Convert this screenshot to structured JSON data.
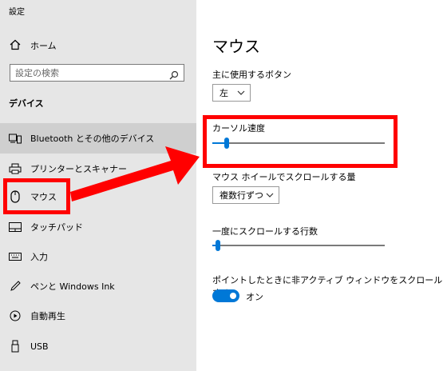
{
  "app_title": "設定",
  "home": {
    "label": "ホーム",
    "icon": "home-icon"
  },
  "search": {
    "placeholder": "設定の検索",
    "icon": "search-icon"
  },
  "section_title": "デバイス",
  "sidebar": {
    "items": [
      {
        "label": "Bluetooth とその他のデバイス",
        "icon": "bluetooth-devices-icon",
        "hover": true
      },
      {
        "label": "プリンターとスキャナー",
        "icon": "printer-icon"
      },
      {
        "label": "マウス",
        "icon": "mouse-icon",
        "selected": true
      },
      {
        "label": "タッチパッド",
        "icon": "touchpad-icon"
      },
      {
        "label": "入力",
        "icon": "keyboard-icon"
      },
      {
        "label": "ペンと Windows Ink",
        "icon": "pen-icon"
      },
      {
        "label": "自動再生",
        "icon": "autoplay-icon"
      },
      {
        "label": "USB",
        "icon": "usb-icon"
      }
    ]
  },
  "main": {
    "title": "マウス",
    "primary_button": {
      "label": "主に使用するボタン",
      "value": "左"
    },
    "cursor_speed": {
      "label": "カーソル速度",
      "value": 0.07
    },
    "wheel_scroll": {
      "label": "マウス ホイールでスクロールする量",
      "value": "複数行ずつ"
    },
    "scroll_lines": {
      "label": "一度にスクロールする行数",
      "value": 0.02
    },
    "inactive_scroll": {
      "label": "ポイントしたときに非アクティブ ウィンドウをスクロールする",
      "state_label": "オン",
      "on": true
    }
  },
  "colors": {
    "accent": "#0078d7",
    "highlight": "#ff0000",
    "sidebar_bg": "#e6e6e6",
    "hover_bg": "#cfcfcf"
  }
}
